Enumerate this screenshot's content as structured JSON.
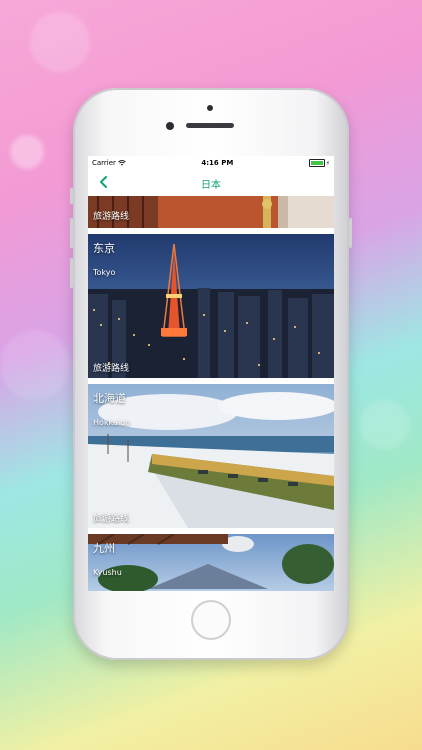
{
  "status_bar": {
    "carrier": "Carrier",
    "time": "4:16 PM"
  },
  "nav": {
    "title": "日本",
    "back_icon": "chevron-left-icon"
  },
  "cards": [
    {
      "name": "",
      "name_en": "",
      "route_label": "旅游路线"
    },
    {
      "name": "东京",
      "name_en": "Tokyo",
      "route_label": "旅游路线"
    },
    {
      "name": "北海道",
      "name_en": "Hokkaido",
      "route_label": "旅游路线"
    },
    {
      "name": "九州",
      "name_en": "Kyushu",
      "route_label": ""
    }
  ],
  "colors": {
    "accent": "#0ea36e"
  }
}
